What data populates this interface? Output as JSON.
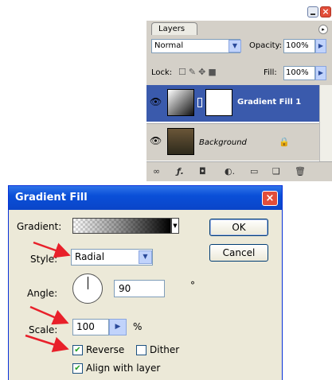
{
  "layers_panel": {
    "tab_label": "Layers",
    "blend_mode": "Normal",
    "opacity_label": "Opacity:",
    "opacity_value": "100%",
    "lock_label": "Lock:",
    "fill_label": "Fill:",
    "fill_value": "100%",
    "layers": [
      {
        "name": "Gradient Fill 1",
        "selected": true,
        "visible": true
      },
      {
        "name": "Background",
        "selected": false,
        "visible": true,
        "locked": true
      }
    ],
    "footer_icons": [
      "link-icon",
      "fx-icon",
      "mask-icon",
      "adjustment-icon",
      "group-icon",
      "new-layer-icon",
      "trash-icon"
    ]
  },
  "dialog": {
    "title": "Gradient Fill",
    "gradient_label": "Gradient:",
    "style_label": "Style:",
    "style_value": "Radial",
    "angle_label": "Angle:",
    "angle_value": "90",
    "angle_unit": "°",
    "scale_label": "Scale:",
    "scale_value": "100",
    "scale_unit": "%",
    "reverse_label": "Reverse",
    "reverse_checked": true,
    "dither_label": "Dither",
    "dither_checked": false,
    "align_label": "Align with layer",
    "align_checked": true,
    "ok_label": "OK",
    "cancel_label": "Cancel"
  },
  "colors": {
    "selection_blue": "#3a5aac",
    "titlebar_blue": "#0a4fd8",
    "close_red": "#e24e3a",
    "arrow_red": "#e8202a"
  }
}
